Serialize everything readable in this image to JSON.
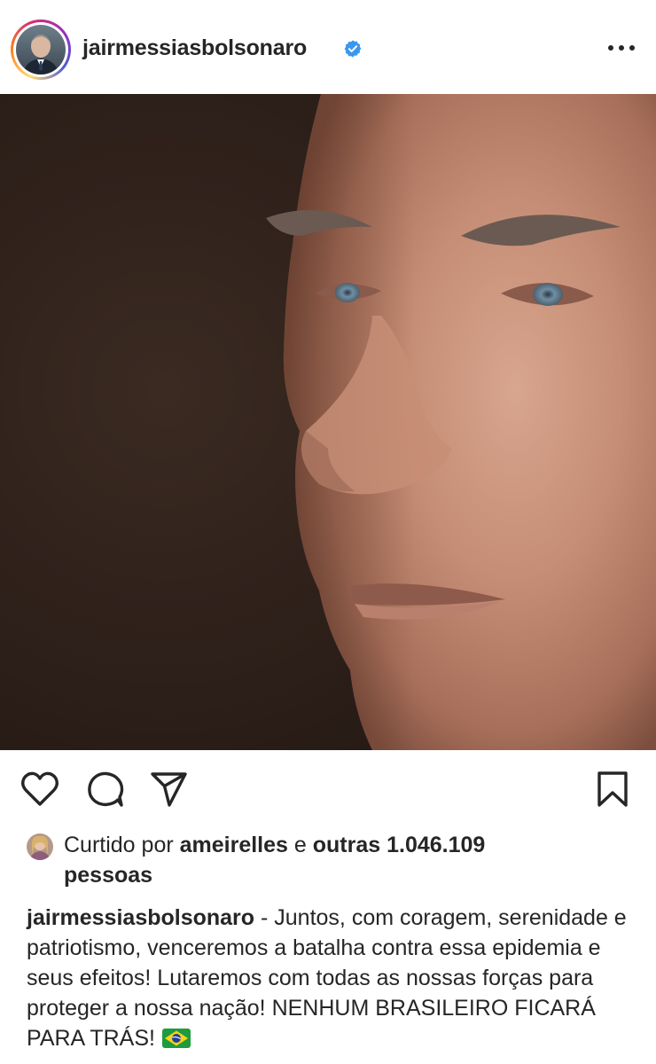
{
  "post": {
    "username": "jairmessiasbolsonaro",
    "verified": true,
    "icons": {
      "avatar": "profile-photo",
      "verified": "verified-badge-icon",
      "more": "more-options-icon",
      "like": "heart-icon",
      "comment": "comment-icon",
      "share": "send-icon",
      "save": "bookmark-icon",
      "flag": "brazil-flag-emoji"
    },
    "photo_description_icon": "post-photo"
  },
  "likes": {
    "prefix": "Curtido por",
    "liker": "ameirelles",
    "joiner": "e",
    "others": "outras 1.046.109",
    "suffix": "pessoas"
  },
  "caption": {
    "username": "jairmessiasbolsonaro",
    "text": " - Juntos, com coragem, serenidade e patriotismo, venceremos a batalha contra essa epidemia e seus efeitos! Lutaremos com todas as nossas forças para proteger a nossa nação! NENHUM BRASILEIRO FICARÁ PARA TRÁS!"
  },
  "colors": {
    "text": "#262626",
    "verified": "#3897f0",
    "background": "#ffffff"
  }
}
